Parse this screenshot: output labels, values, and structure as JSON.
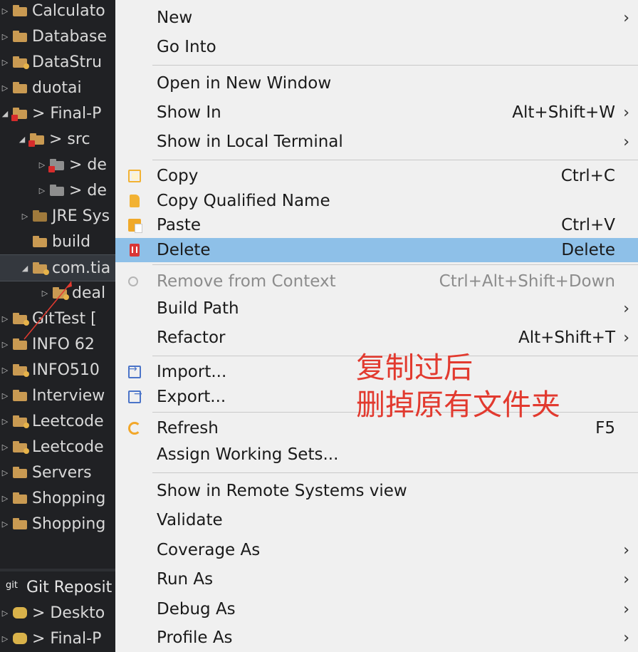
{
  "tree": {
    "items": [
      {
        "label": "Calculato",
        "icon": "project-folder-icon"
      },
      {
        "label": "Database",
        "icon": "project-folder-icon"
      },
      {
        "label": "DataStru",
        "icon": "project-folder-icon"
      },
      {
        "label": "duotai",
        "icon": "project-folder-icon"
      },
      {
        "label": "> Final-P",
        "icon": "project-error-folder-icon"
      },
      {
        "label": "> src",
        "icon": "package-folder-icon"
      },
      {
        "label": "> de",
        "icon": "package-icon"
      },
      {
        "label": "> de",
        "icon": "package-icon"
      },
      {
        "label": "JRE Sys",
        "icon": "library-icon"
      },
      {
        "label": "build",
        "icon": "folder-icon"
      },
      {
        "label": "com.tia",
        "icon": "folder-icon"
      },
      {
        "label": "deal",
        "icon": "folder-icon"
      },
      {
        "label": "GitTest [",
        "icon": "project-folder-icon"
      },
      {
        "label": "INFO 62",
        "icon": "project-folder-icon"
      },
      {
        "label": "INFO510",
        "icon": "project-folder-icon"
      },
      {
        "label": "Interview",
        "icon": "project-folder-icon"
      },
      {
        "label": "Leetcode",
        "icon": "project-folder-icon"
      },
      {
        "label": "Leetcode",
        "icon": "project-folder-icon"
      },
      {
        "label": "Servers",
        "icon": "folder-icon"
      },
      {
        "label": "Shopping",
        "icon": "project-folder-icon"
      },
      {
        "label": "Shopping",
        "icon": "project-folder-icon"
      }
    ],
    "git_panel": {
      "title": "Git Reposit",
      "items": [
        {
          "label": "> Deskto",
          "icon": "repository-icon"
        },
        {
          "label": "> Final-P",
          "icon": "repository-icon"
        }
      ]
    }
  },
  "menu": {
    "items": [
      {
        "label": "New",
        "shortcut": "",
        "submenu": true
      },
      {
        "label": "Go Into",
        "shortcut": "",
        "submenu": false
      },
      {
        "label": "Open in New Window",
        "shortcut": "",
        "submenu": false
      },
      {
        "label": "Show In",
        "shortcut": "Alt+Shift+W",
        "submenu": true
      },
      {
        "label": "Show in Local Terminal",
        "shortcut": "",
        "submenu": true
      },
      {
        "label": "Copy",
        "shortcut": "Ctrl+C",
        "submenu": false,
        "icon": "copy-icon"
      },
      {
        "label": "Copy Qualified Name",
        "shortcut": "",
        "submenu": false,
        "icon": "copy-qualified-name-icon"
      },
      {
        "label": "Paste",
        "shortcut": "Ctrl+V",
        "submenu": false,
        "icon": "paste-icon"
      },
      {
        "label": "Delete",
        "shortcut": "Delete",
        "submenu": false,
        "icon": "delete-icon",
        "highlighted": true
      },
      {
        "label": "Remove from Context",
        "shortcut": "Ctrl+Alt+Shift+Down",
        "submenu": false,
        "icon": "remove-context-icon",
        "disabled": true
      },
      {
        "label": "Build Path",
        "shortcut": "",
        "submenu": true
      },
      {
        "label": "Refactor",
        "shortcut": "Alt+Shift+T",
        "submenu": true
      },
      {
        "label": "Import...",
        "shortcut": "",
        "submenu": false,
        "icon": "import-icon"
      },
      {
        "label": "Export...",
        "shortcut": "",
        "submenu": false,
        "icon": "export-icon"
      },
      {
        "label": "Refresh",
        "shortcut": "F5",
        "submenu": false,
        "icon": "refresh-icon"
      },
      {
        "label": "Assign Working Sets...",
        "shortcut": "",
        "submenu": false
      },
      {
        "label": "Show in Remote Systems view",
        "shortcut": "",
        "submenu": false
      },
      {
        "label": "Validate",
        "shortcut": "",
        "submenu": false
      },
      {
        "label": "Coverage As",
        "shortcut": "",
        "submenu": true
      },
      {
        "label": "Run As",
        "shortcut": "",
        "submenu": true
      },
      {
        "label": "Debug As",
        "shortcut": "",
        "submenu": true
      },
      {
        "label": "Profile As",
        "shortcut": "",
        "submenu": true
      }
    ],
    "submenu_glyph": "›"
  },
  "annotation": {
    "line1": "复制过后",
    "line2": "删掉原有文件夹",
    "color": "#e23a2f"
  },
  "colors": {
    "highlight": "#8ec0e8",
    "menu_bg": "#f0f0f0",
    "tree_bg": "#202124"
  }
}
